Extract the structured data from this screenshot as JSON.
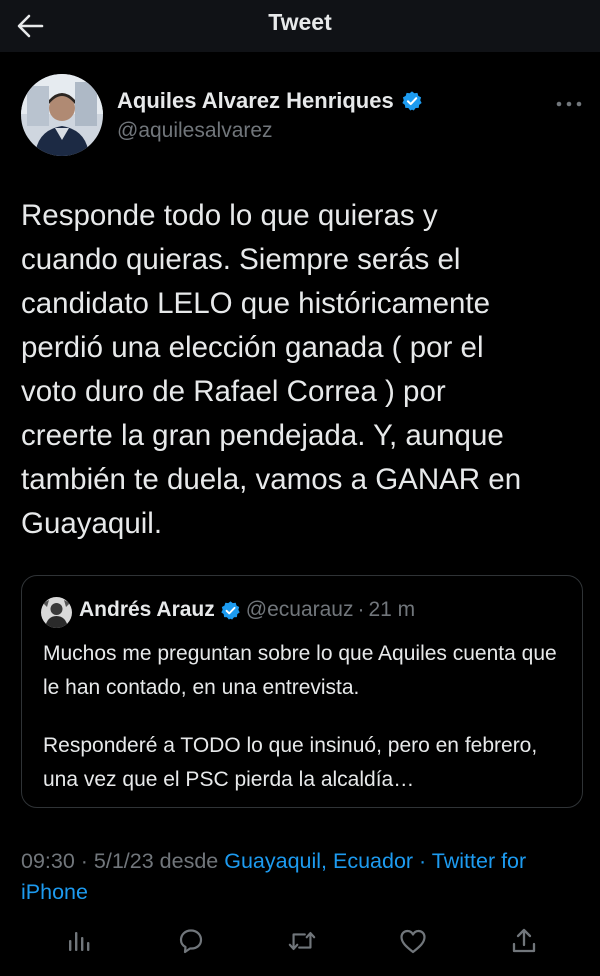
{
  "header": {
    "title": "Tweet"
  },
  "author": {
    "name": "Aquiles Alvarez Henriques",
    "handle": "@aquilesalvarez",
    "verified": true
  },
  "tweet": {
    "text": "Responde todo lo que quieras y\ncuando quieras. Siempre serás el\ncandidato LELO que históricamente\nperdió una elección ganada ( por el\nvoto duro de Rafael Correa ) por\ncreerte la gran pendejada. Y, aunque\ntambién te duela, vamos a GANAR en\nGuayaquil."
  },
  "quote": {
    "name": "Andrés Arauz",
    "handle": "@ecuarauz",
    "separator": "·",
    "time": "21 m",
    "paragraph1": "Muchos me preguntan sobre lo que Aquiles cuenta que le han contado, en una entrevista.",
    "paragraph2": "Responderé a TODO lo que insinuó, pero en febrero, una vez que el PSC pierda la alcaldía…"
  },
  "meta": {
    "time": "09:30",
    "sep1": " · ",
    "date": "5/1/23",
    "from": " desde ",
    "location": "Guayaquil, Ecuador",
    "sep2": " · ",
    "client": "Twitter for iPhone"
  },
  "actions": {
    "icons": [
      "analytics-icon",
      "reply-icon",
      "retweet-icon",
      "like-icon",
      "share-icon"
    ]
  },
  "colors": {
    "background": "#000000",
    "topbar": "#101216",
    "text": "#e7e9ea",
    "secondary": "#71767b",
    "accent": "#1d9bf0",
    "border": "#2f3336"
  }
}
